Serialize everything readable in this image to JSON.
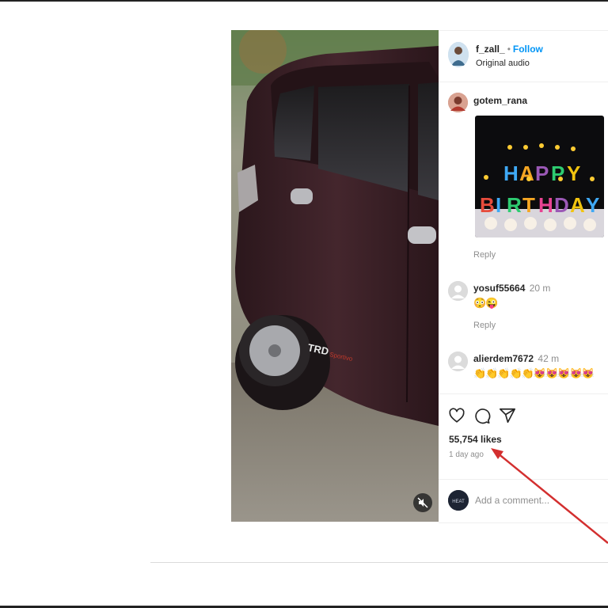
{
  "post": {
    "author": "f_zall_",
    "follow_label": "Follow",
    "separator": "•",
    "audio": "Original audio"
  },
  "comments": [
    {
      "user": "gotem_rana",
      "time": "",
      "gif_caption": "HAPPY BIRTHDAY",
      "reply_label": "Reply"
    },
    {
      "user": "yosuf55664",
      "time": "20 m",
      "text": "😳😜",
      "reply_label": "Reply"
    },
    {
      "user": "alierdem7672",
      "time": "42 m",
      "text": "👏👏👏👏👏😻😻😻😻😻"
    }
  ],
  "actions": {
    "icons": [
      "heart-icon",
      "comment-icon",
      "share-icon"
    ],
    "likes": "55,754 likes",
    "time_ago": "1 day ago"
  },
  "add_comment": {
    "placeholder": "Add a comment..."
  },
  "colors": {
    "accent": "#0095f6",
    "arrow": "#d32f2f",
    "car": "#3a1f25"
  }
}
